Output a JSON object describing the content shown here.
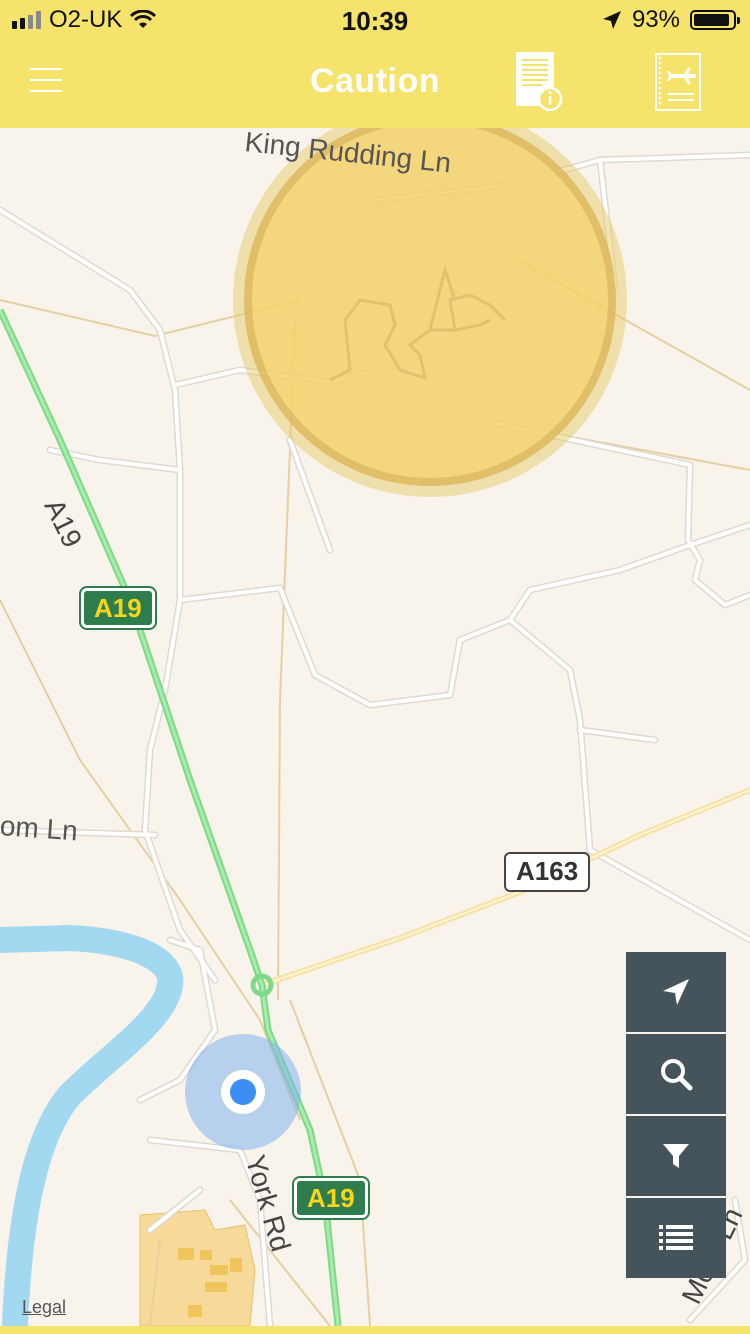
{
  "status_bar": {
    "carrier": "O2-UK",
    "time": "10:39",
    "battery": "93%",
    "battery_level": 0.93,
    "signal_bars": 2,
    "icons": [
      "signal-icon",
      "wifi-icon",
      "location-arrow-icon",
      "battery-icon"
    ]
  },
  "nav": {
    "title": "Caution",
    "icons": [
      "menu-icon",
      "info-document-icon",
      "flight-plan-icon"
    ]
  },
  "map": {
    "roads": {
      "king_rudding": "King Rudding Ln",
      "a19": "A19",
      "york_rd": "York Rd",
      "moor_ln": "Moor Ln",
      "om_ln": "om Ln"
    },
    "shields": {
      "a19_upper": "A19",
      "a19_lower": "A19",
      "a163": "A163"
    },
    "legal": "Legal",
    "colors": {
      "caution_zone": "#f7cf55",
      "primary_road": "#8fe08f",
      "river": "#a3d9f0",
      "secondary_road": "#f7e1a3",
      "user_location": "#3b8ef3",
      "header": "#f5e36b",
      "control_button": "#45545b"
    }
  },
  "controls": {
    "icons": [
      "locate-icon",
      "search-icon",
      "filter-icon",
      "list-icon"
    ]
  }
}
